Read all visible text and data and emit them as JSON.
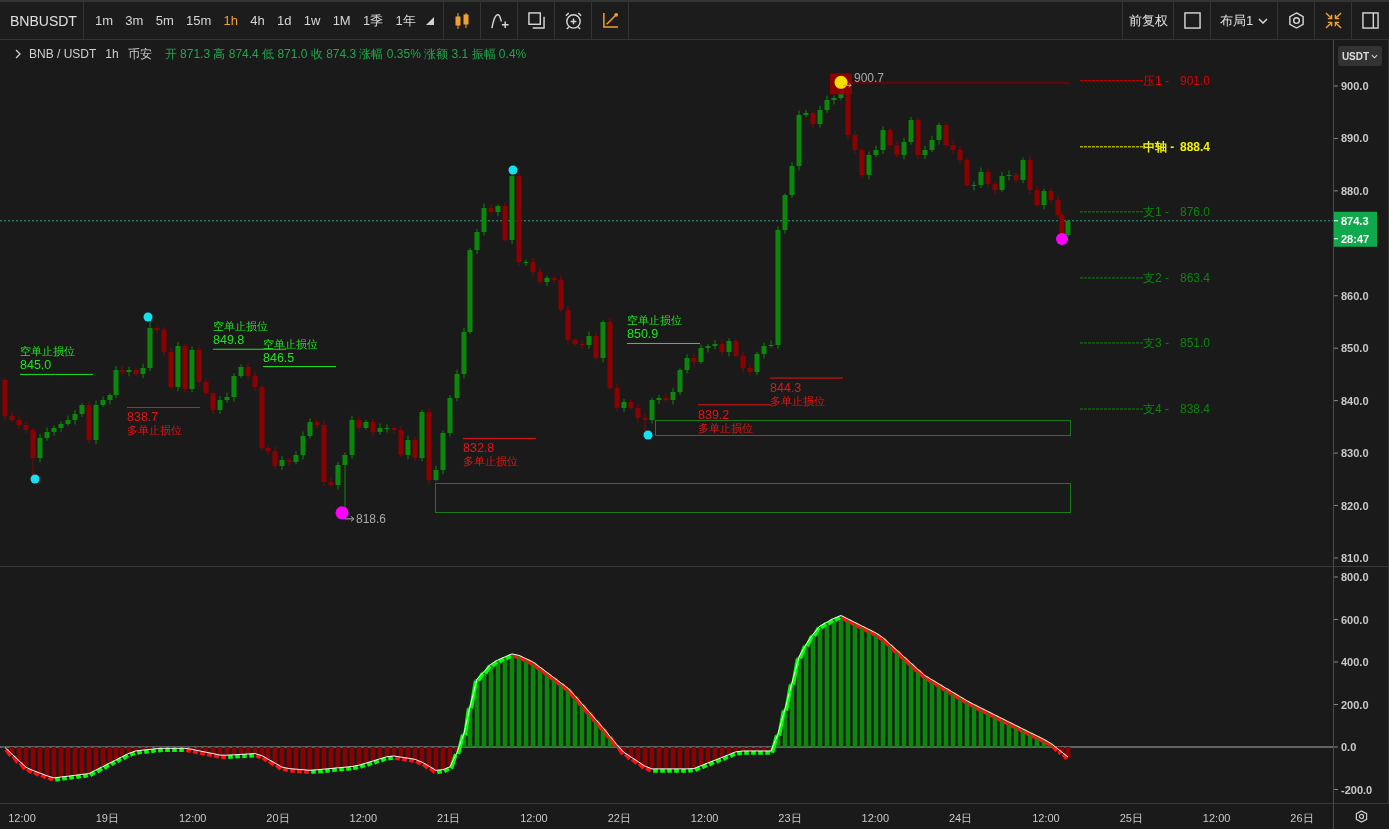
{
  "toolbar": {
    "symbol": "BNBUSDT",
    "intervals": [
      {
        "label": "1m",
        "selected": false
      },
      {
        "label": "3m",
        "selected": false
      },
      {
        "label": "5m",
        "selected": false
      },
      {
        "label": "15m",
        "selected": false
      },
      {
        "label": "1h",
        "selected": true
      },
      {
        "label": "4h",
        "selected": false
      },
      {
        "label": "1d",
        "selected": false
      },
      {
        "label": "1w",
        "selected": false
      },
      {
        "label": "1M",
        "selected": false
      },
      {
        "label": "1季",
        "selected": false
      },
      {
        "label": "1年",
        "selected": false
      }
    ],
    "adjustment": "前复权",
    "layout": "布局1"
  },
  "legend": {
    "pair": "BNB / USDT",
    "interval": "1h",
    "exchange": "币安",
    "quote": "开 871.3 高 874.4 低 871.0 收 874.3 涨幅 0.35% 涨额 3.1 振幅 0.4%"
  },
  "price_chart": {
    "pivot_levels": [
      {
        "kind": "resistance",
        "label": "压1 -",
        "value": "901.0"
      },
      {
        "kind": "pivot",
        "label": "中轴 -",
        "value": "888.4"
      },
      {
        "kind": "support",
        "label": "支1 -",
        "value": "876.0"
      },
      {
        "kind": "support",
        "label": "支2 -",
        "value": "863.4"
      },
      {
        "kind": "support",
        "label": "支3 -",
        "value": "851.0"
      },
      {
        "kind": "support",
        "label": "支4 -",
        "value": "838.4"
      }
    ],
    "stop_levels": [
      {
        "kind": "short_stop",
        "label": "空单止损位",
        "value": "845.0"
      },
      {
        "kind": "long_stop",
        "label": "多单止损位",
        "value": "838.7"
      },
      {
        "kind": "short_stop",
        "label": "空单止损位",
        "value": "849.8"
      },
      {
        "kind": "short_stop",
        "label": "空单止损位",
        "value": "846.5"
      },
      {
        "kind": "long_stop",
        "label": "多单止损位",
        "value": "832.8"
      },
      {
        "kind": "short_stop",
        "label": "空单止损位",
        "value": "850.9"
      },
      {
        "kind": "long_stop",
        "label": "多单止损位",
        "value": "839.2"
      },
      {
        "kind": "long_stop",
        "label": "多单止损位",
        "value": "844.3"
      }
    ],
    "extremes": [
      {
        "kind": "low",
        "value": "818.6"
      },
      {
        "kind": "high",
        "value": "900.7"
      }
    ]
  },
  "price_axis": {
    "currency": "USDT",
    "ticks": [
      "900.0",
      "890.0",
      "880.0",
      "860.0",
      "850.0",
      "840.0",
      "830.0",
      "820.0",
      "810.0"
    ],
    "last_price": "874.3",
    "countdown": "28:47"
  },
  "macd_axis": {
    "ticks": [
      "800.0",
      "600.0",
      "400.0",
      "200.0",
      "0.0",
      "-200.0"
    ]
  },
  "time_axis": {
    "labels": [
      "12:00",
      "19日",
      "12:00",
      "20日",
      "12:00",
      "21日",
      "12:00",
      "22日",
      "12:00",
      "23日",
      "12:00",
      "24日",
      "12:00",
      "25日",
      "12:00",
      "26日"
    ]
  }
}
